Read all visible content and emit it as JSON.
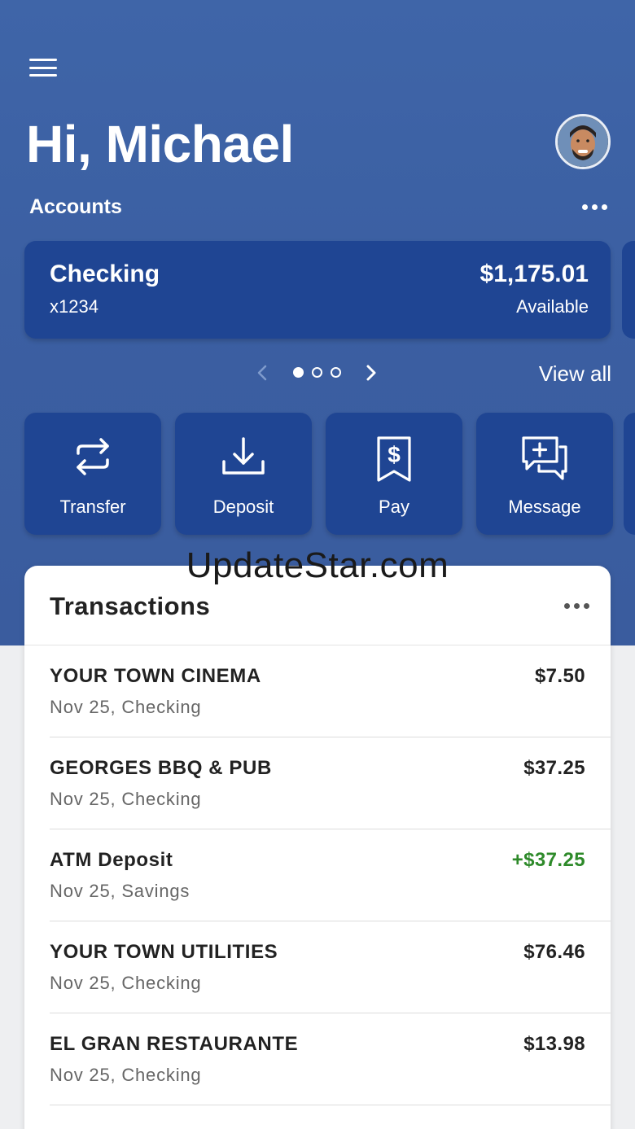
{
  "header": {
    "greeting": "Hi, Michael",
    "menu_icon": "hamburger-menu-icon",
    "avatar_icon": "user-avatar"
  },
  "accounts": {
    "label": "Accounts",
    "card": {
      "name": "Checking",
      "number": "x1234",
      "balance": "$1,175.01",
      "balance_label": "Available"
    },
    "pager": {
      "count": 3,
      "active_index": 0
    },
    "view_all": "View all"
  },
  "actions": [
    {
      "label": "Transfer",
      "icon": "transfer-arrows-icon"
    },
    {
      "label": "Deposit",
      "icon": "download-tray-icon"
    },
    {
      "label": "Pay",
      "icon": "dollar-receipt-icon"
    },
    {
      "label": "Message",
      "icon": "message-plus-icon"
    }
  ],
  "watermark": "UpdateStar.com",
  "transactions": {
    "title": "Transactions",
    "items": [
      {
        "merchant": "YOUR TOWN CINEMA",
        "meta": "Nov 25, Checking",
        "amount": "$7.50",
        "credit": false
      },
      {
        "merchant": "GEORGES BBQ & PUB",
        "meta": "Nov 25, Checking",
        "amount": "$37.25",
        "credit": false
      },
      {
        "merchant": "ATM Deposit",
        "meta": "Nov 25, Savings",
        "amount": "+$37.25",
        "credit": true
      },
      {
        "merchant": "YOUR TOWN UTILITIES",
        "meta": "Nov 25, Checking",
        "amount": "$76.46",
        "credit": false
      },
      {
        "merchant": "EL GRAN RESTAURANTE",
        "meta": "Nov 25, Checking",
        "amount": "$13.98",
        "credit": false
      }
    ]
  },
  "colors": {
    "hero_bg": "#3d62a6",
    "card_bg": "#1f4593",
    "credit": "#2e8a2a"
  }
}
